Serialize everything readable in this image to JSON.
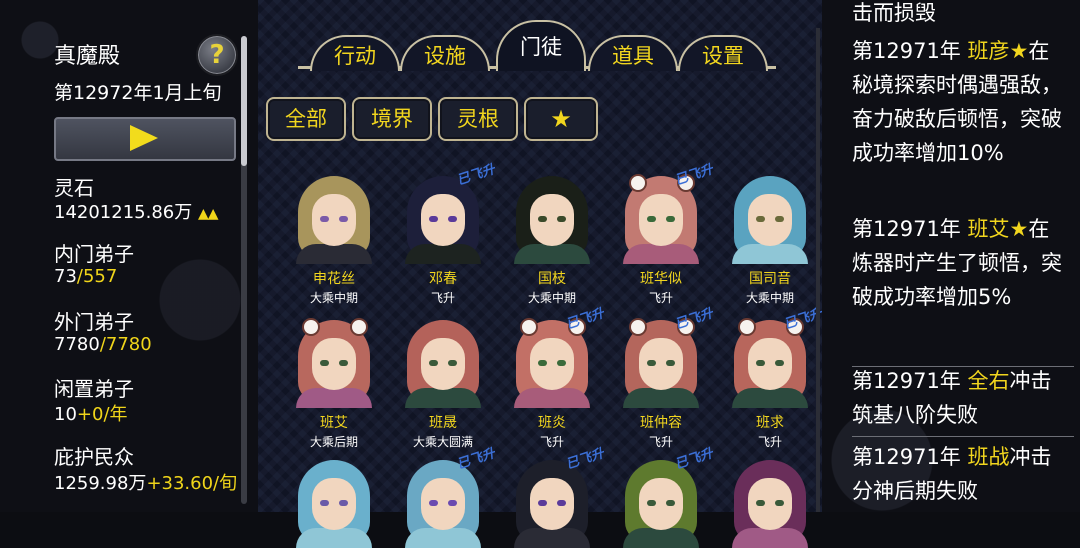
{
  "sect": {
    "name": "真魔殿",
    "date": "第12972年1月上旬",
    "help_label": "?"
  },
  "stats": [
    {
      "label": "灵石",
      "value": "14201215.86万",
      "extra": "▲▲"
    },
    {
      "label": "内门弟子",
      "value": "73",
      "extra": "/557"
    },
    {
      "label": "外门弟子",
      "value": "7780",
      "extra": "/7780"
    },
    {
      "label": "闲置弟子",
      "value": "10",
      "extra": "+0/年"
    },
    {
      "label": "庇护民众",
      "value": "1259.98万",
      "extra": "+33.60/旬"
    }
  ],
  "tabs": [
    {
      "label": "行动"
    },
    {
      "label": "设施"
    },
    {
      "label": "门徒"
    },
    {
      "label": "道具"
    },
    {
      "label": "设置"
    }
  ],
  "filters": [
    {
      "label": "全部"
    },
    {
      "label": "境界"
    },
    {
      "label": "灵根"
    },
    {
      "label": "★"
    }
  ],
  "disciples": [
    {
      "name": "申花丝",
      "rank": "大乘中期",
      "badge": "",
      "hair": "#a8955c",
      "robe": "#2a2b35",
      "eye": "#7a5aa8",
      "ears": false
    },
    {
      "name": "邓春",
      "rank": "飞升",
      "badge": "已飞升",
      "hair": "#1d1f3a",
      "robe": "#1d2320",
      "eye": "#5a3a9a",
      "ears": false
    },
    {
      "name": "国枝",
      "rank": "大乘中期",
      "badge": "",
      "hair": "#1a1f18",
      "robe": "#2c4a3e",
      "eye": "#3a4a2a",
      "ears": false
    },
    {
      "name": "班华似",
      "rank": "飞升",
      "badge": "已飞升",
      "hair": "#c27a72",
      "robe": "#a85c7a",
      "eye": "#3a6a3a",
      "ears": true
    },
    {
      "name": "国司音",
      "rank": "大乘中期",
      "badge": "",
      "hair": "#5aa3c0",
      "robe": "#8fc6d6",
      "eye": "#6a6a3a",
      "ears": false
    },
    {
      "name": "班艾",
      "rank": "大乘后期",
      "badge": "",
      "hair": "#b8685e",
      "robe": "#a05a86",
      "eye": "#3a5a3a",
      "ears": true
    },
    {
      "name": "班晟",
      "rank": "大乘大圆满",
      "badge": "",
      "hair": "#b4625a",
      "robe": "#2c4a3e",
      "eye": "#3a5a3a",
      "ears": false
    },
    {
      "name": "班炎",
      "rank": "飞升",
      "badge": "已飞升",
      "hair": "#c27066",
      "robe": "#a85c7a",
      "eye": "#3a6a3a",
      "ears": true
    },
    {
      "name": "班仲容",
      "rank": "飞升",
      "badge": "已飞升",
      "hair": "#b4665c",
      "robe": "#2c4a3e",
      "eye": "#3a5a3a",
      "ears": true
    },
    {
      "name": "班求",
      "rank": "飞升",
      "badge": "已飞升",
      "hair": "#b8665c",
      "robe": "#2c4a3e",
      "eye": "#3a5a3a",
      "ears": true
    },
    {
      "name": "",
      "rank": "",
      "badge": "",
      "hair": "#6ab0cc",
      "robe": "#8fc6d6",
      "eye": "#6a5aa8",
      "ears": false
    },
    {
      "name": "",
      "rank": "",
      "badge": "已飞升",
      "hair": "#6aa8c4",
      "robe": "#8fc6d6",
      "eye": "#6a4ab0",
      "ears": false
    },
    {
      "name": "",
      "rank": "",
      "badge": "已飞升",
      "hair": "#1d1f2a",
      "robe": "#2a2b35",
      "eye": "#5a3a9a",
      "ears": false
    },
    {
      "name": "",
      "rank": "",
      "badge": "已飞升",
      "hair": "#5e7a2e",
      "robe": "#2c4a3e",
      "eye": "#3a5a3a",
      "ears": false
    },
    {
      "name": "",
      "rank": "",
      "badge": "",
      "hair": "#6a2e5a",
      "robe": "#a05a86",
      "eye": "#3a5a3a",
      "ears": false
    }
  ],
  "log": [
    {
      "year": "",
      "name": "",
      "text": "击而损毁"
    },
    {
      "year": "第12971年",
      "name": "班彦★",
      "text": "在秘境探索时偶遇强敌，奋力破敌后顿悟，突破成功率增加10%"
    },
    {
      "year": "第12971年",
      "name": "班艾★",
      "text": "在炼器时产生了顿悟，突破成功率增加5%"
    },
    {
      "year": "第12971年",
      "name": "全右",
      "text": "冲击筑基八阶失败"
    },
    {
      "year": "第12971年",
      "name": "班战",
      "text": "冲击分神后期失败"
    }
  ]
}
